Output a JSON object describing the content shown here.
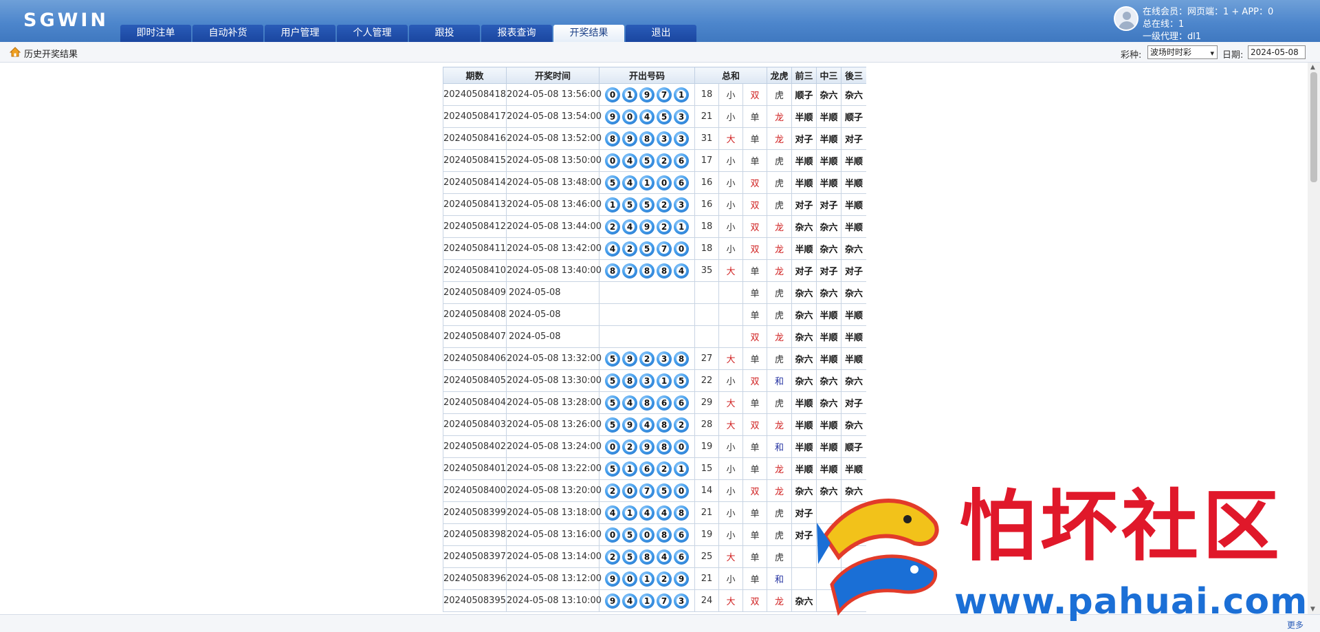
{
  "header": {
    "logo": "SGWIN",
    "nav": [
      "即时注单",
      "自动补货",
      "用户管理",
      "个人管理",
      "跟投",
      "报表查询",
      "开奖结果",
      "退出"
    ],
    "active_index": 6,
    "user_lines": [
      "在线会员：网页端：1 + APP：0",
      "总在线：1",
      "一级代理：dl1"
    ]
  },
  "subbar": {
    "title": "历史开奖结果",
    "lottery_label": "彩种:",
    "lottery_value": "波场时时彩",
    "date_label": "日期:",
    "date_value": "2024-05-08"
  },
  "table": {
    "headers": [
      "期数",
      "开奖时间",
      "开出号码",
      "总和",
      "龙虎",
      "前三",
      "中三",
      "後三"
    ],
    "rows": [
      {
        "period": "20240508418",
        "time": "2024-05-08 13:56:00",
        "balls": [
          "0",
          "1",
          "9",
          "7",
          "1"
        ],
        "sum": "18",
        "size": "小",
        "parity": "双",
        "lh": "虎",
        "q3": "顺子",
        "z3": "杂六",
        "h3": "杂六"
      },
      {
        "period": "20240508417",
        "time": "2024-05-08 13:54:00",
        "balls": [
          "9",
          "0",
          "4",
          "5",
          "3"
        ],
        "sum": "21",
        "size": "小",
        "parity": "单",
        "lh": "龙",
        "q3": "半顺",
        "z3": "半顺",
        "h3": "顺子"
      },
      {
        "period": "20240508416",
        "time": "2024-05-08 13:52:00",
        "balls": [
          "8",
          "9",
          "8",
          "3",
          "3"
        ],
        "sum": "31",
        "size": "大",
        "parity": "单",
        "lh": "龙",
        "q3": "对子",
        "z3": "半顺",
        "h3": "对子"
      },
      {
        "period": "20240508415",
        "time": "2024-05-08 13:50:00",
        "balls": [
          "0",
          "4",
          "5",
          "2",
          "6"
        ],
        "sum": "17",
        "size": "小",
        "parity": "单",
        "lh": "虎",
        "q3": "半顺",
        "z3": "半顺",
        "h3": "半顺"
      },
      {
        "period": "20240508414",
        "time": "2024-05-08 13:48:00",
        "balls": [
          "5",
          "4",
          "1",
          "0",
          "6"
        ],
        "sum": "16",
        "size": "小",
        "parity": "双",
        "lh": "虎",
        "q3": "半顺",
        "z3": "半顺",
        "h3": "半顺"
      },
      {
        "period": "20240508413",
        "time": "2024-05-08 13:46:00",
        "balls": [
          "1",
          "5",
          "5",
          "2",
          "3"
        ],
        "sum": "16",
        "size": "小",
        "parity": "双",
        "lh": "虎",
        "q3": "对子",
        "z3": "对子",
        "h3": "半顺"
      },
      {
        "period": "20240508412",
        "time": "2024-05-08 13:44:00",
        "balls": [
          "2",
          "4",
          "9",
          "2",
          "1"
        ],
        "sum": "18",
        "size": "小",
        "parity": "双",
        "lh": "龙",
        "q3": "杂六",
        "z3": "杂六",
        "h3": "半顺"
      },
      {
        "period": "20240508411",
        "time": "2024-05-08 13:42:00",
        "balls": [
          "4",
          "2",
          "5",
          "7",
          "0"
        ],
        "sum": "18",
        "size": "小",
        "parity": "双",
        "lh": "龙",
        "q3": "半顺",
        "z3": "杂六",
        "h3": "杂六"
      },
      {
        "period": "20240508410",
        "time": "2024-05-08 13:40:00",
        "balls": [
          "8",
          "7",
          "8",
          "8",
          "4"
        ],
        "sum": "35",
        "size": "大",
        "parity": "单",
        "lh": "龙",
        "q3": "对子",
        "z3": "对子",
        "h3": "对子"
      },
      {
        "period": "20240508409",
        "time": "2024-05-08",
        "blurred": true,
        "parity": "单",
        "lh": "虎",
        "q3": "杂六",
        "z3": "杂六",
        "h3": "杂六"
      },
      {
        "period": "20240508408",
        "time": "2024-05-08",
        "blurred": true,
        "parity": "单",
        "lh": "虎",
        "q3": "杂六",
        "z3": "半顺",
        "h3": "半顺"
      },
      {
        "period": "20240508407",
        "time": "2024-05-08",
        "blurred": true,
        "parity": "双",
        "lh": "龙",
        "q3": "杂六",
        "z3": "半顺",
        "h3": "半顺"
      },
      {
        "period": "20240508406",
        "time": "2024-05-08 13:32:00",
        "balls": [
          "5",
          "9",
          "2",
          "3",
          "8"
        ],
        "sum": "27",
        "size": "大",
        "parity": "单",
        "lh": "虎",
        "q3": "杂六",
        "z3": "半顺",
        "h3": "半顺"
      },
      {
        "period": "20240508405",
        "time": "2024-05-08 13:30:00",
        "balls": [
          "5",
          "8",
          "3",
          "1",
          "5"
        ],
        "sum": "22",
        "size": "小",
        "parity": "双",
        "lh": "和",
        "q3": "杂六",
        "z3": "杂六",
        "h3": "杂六"
      },
      {
        "period": "20240508404",
        "time": "2024-05-08 13:28:00",
        "balls": [
          "5",
          "4",
          "8",
          "6",
          "6"
        ],
        "sum": "29",
        "size": "大",
        "parity": "单",
        "lh": "虎",
        "q3": "半顺",
        "z3": "杂六",
        "h3": "对子"
      },
      {
        "period": "20240508403",
        "time": "2024-05-08 13:26:00",
        "balls": [
          "5",
          "9",
          "4",
          "8",
          "2"
        ],
        "sum": "28",
        "size": "大",
        "parity": "双",
        "lh": "龙",
        "q3": "半顺",
        "z3": "半顺",
        "h3": "杂六"
      },
      {
        "period": "20240508402",
        "time": "2024-05-08 13:24:00",
        "balls": [
          "0",
          "2",
          "9",
          "8",
          "0"
        ],
        "sum": "19",
        "size": "小",
        "parity": "单",
        "lh": "和",
        "q3": "半顺",
        "z3": "半顺",
        "h3": "顺子"
      },
      {
        "period": "20240508401",
        "time": "2024-05-08 13:22:00",
        "balls": [
          "5",
          "1",
          "6",
          "2",
          "1"
        ],
        "sum": "15",
        "size": "小",
        "parity": "单",
        "lh": "龙",
        "q3": "半顺",
        "z3": "半顺",
        "h3": "半顺"
      },
      {
        "period": "20240508400",
        "time": "2024-05-08 13:20:00",
        "balls": [
          "2",
          "0",
          "7",
          "5",
          "0"
        ],
        "sum": "14",
        "size": "小",
        "parity": "双",
        "lh": "龙",
        "q3": "杂六",
        "z3": "杂六",
        "h3": "杂六"
      },
      {
        "period": "20240508399",
        "time": "2024-05-08 13:18:00",
        "balls": [
          "4",
          "1",
          "4",
          "4",
          "8"
        ],
        "sum": "21",
        "size": "小",
        "parity": "单",
        "lh": "虎",
        "q3": "对子",
        "z3": "",
        "h3": ""
      },
      {
        "period": "20240508398",
        "time": "2024-05-08 13:16:00",
        "balls": [
          "0",
          "5",
          "0",
          "8",
          "6"
        ],
        "sum": "19",
        "size": "小",
        "parity": "单",
        "lh": "虎",
        "q3": "对子",
        "z3": "",
        "h3": ""
      },
      {
        "period": "20240508397",
        "time": "2024-05-08 13:14:00",
        "balls": [
          "2",
          "5",
          "8",
          "4",
          "6"
        ],
        "sum": "25",
        "size": "大",
        "parity": "单",
        "lh": "虎",
        "q3": "",
        "z3": "",
        "h3": ""
      },
      {
        "period": "20240508396",
        "time": "2024-05-08 13:12:00",
        "balls": [
          "9",
          "0",
          "1",
          "2",
          "9"
        ],
        "sum": "21",
        "size": "小",
        "parity": "单",
        "lh": "和",
        "q3": "",
        "z3": "",
        "h3": ""
      },
      {
        "period": "20240508395",
        "time": "2024-05-08 13:10:00",
        "balls": [
          "9",
          "4",
          "1",
          "7",
          "3"
        ],
        "sum": "24",
        "size": "大",
        "parity": "双",
        "lh": "龙",
        "q3": "杂六",
        "z3": "",
        "h3": ""
      }
    ]
  },
  "footer": {
    "more": "更多"
  },
  "watermark": {
    "text": "怕坏社区",
    "url": "www.pahuai.com"
  }
}
